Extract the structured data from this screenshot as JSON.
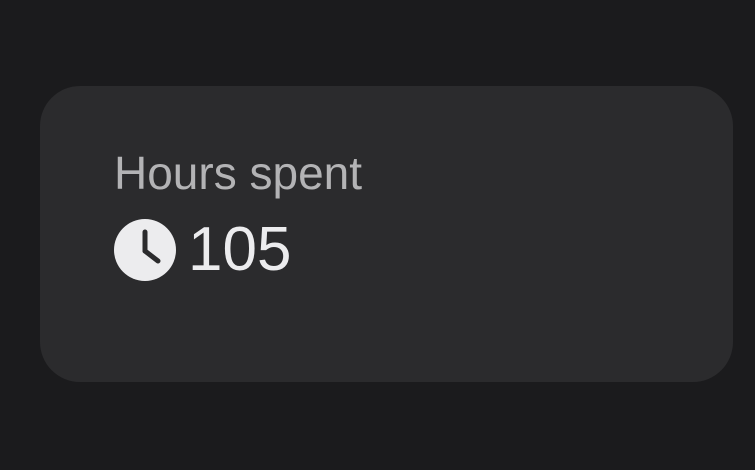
{
  "card": {
    "label": "Hours spent",
    "value": "105",
    "icon": "clock-icon"
  },
  "colors": {
    "page_background": "#1b1b1d",
    "card_background": "#2b2b2d",
    "label_text": "#b3b3b5",
    "value_text": "#ececee"
  }
}
